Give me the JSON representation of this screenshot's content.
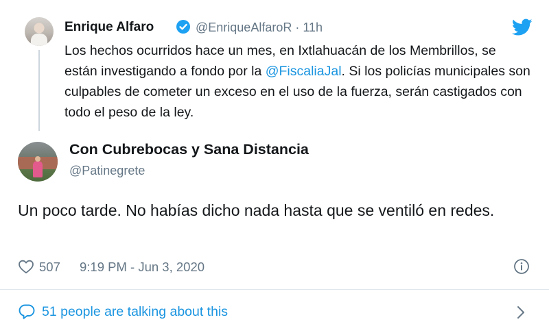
{
  "parent_tweet": {
    "author_name": "Enrique Alfaro",
    "verified_icon": "verified-badge-icon",
    "handle": "@EnriqueAlfaroR",
    "separator": "·",
    "time_ago": "11h",
    "text_before_mention": "Los hechos ocurridos hace un mes, en Ixtlahuacán de los Membrillos, se están investigando a fondo por la ",
    "mention": "@FiscaliaJal",
    "text_after_mention": ". Si los policías municipales son culpables de cometer un exceso en el uso de la fuerza, serán castigados con todo el peso de la ley."
  },
  "reply_tweet": {
    "author_name": "Con Cubrebocas y Sana Distancia",
    "handle": "@Patinegrete",
    "text": "Un poco tarde. No habías dicho nada hasta que se ventiló en redes.",
    "likes": "507",
    "timestamp": "9:19 PM - Jun 3, 2020"
  },
  "conversation": {
    "label": "51 people are talking about this"
  },
  "colors": {
    "twitter_blue": "#1da1f2",
    "link_blue": "#1b95e0",
    "secondary_text": "#657786",
    "primary_text": "#14171a",
    "divider": "#e1e8ed"
  },
  "icons": [
    "twitter-logo-icon",
    "verified-badge-icon",
    "heart-icon",
    "info-icon",
    "speech-bubble-icon",
    "chevron-right-icon"
  ]
}
